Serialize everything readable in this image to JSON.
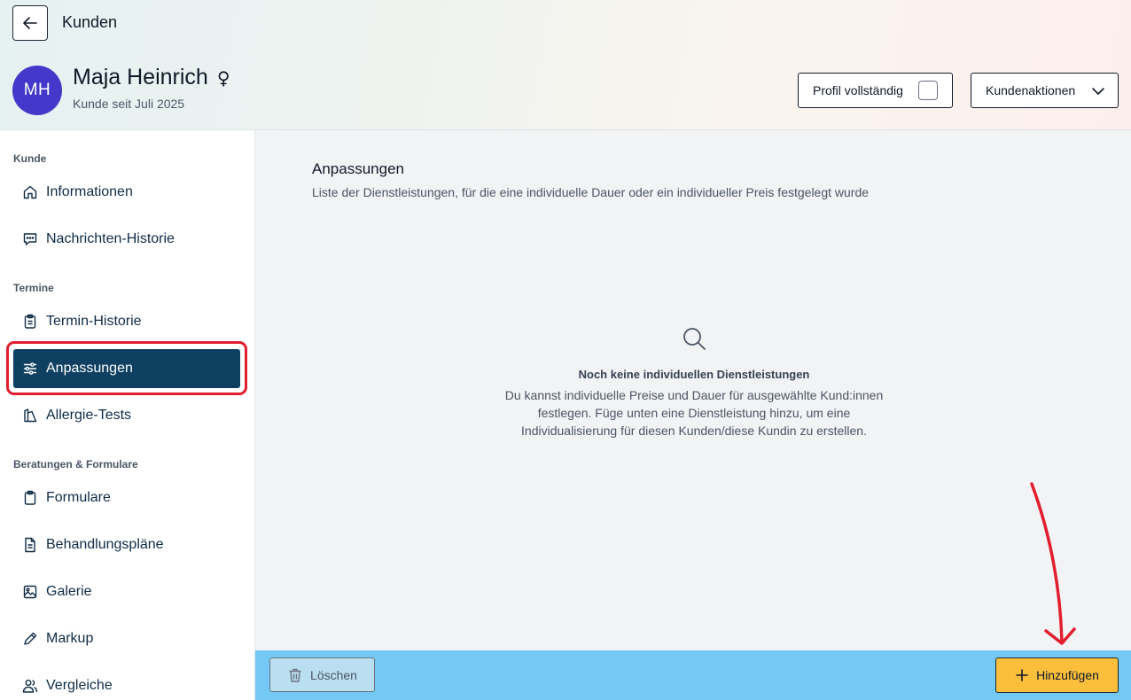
{
  "header": {
    "back_label": "Kunden",
    "customer": {
      "initials": "MH",
      "name": "Maja Heinrich",
      "gender_symbol": "♀",
      "since": "Kunde seit Juli 2025",
      "avatar_color": "#4338ca"
    },
    "profile_complete_label": "Profil vollständig",
    "profile_complete_checked": false,
    "actions_label": "Kundenaktionen"
  },
  "sidebar": {
    "sections": [
      {
        "label": "Kunde",
        "items": [
          {
            "label": "Informationen",
            "icon": "home-icon"
          },
          {
            "label": "Nachrichten-Historie",
            "icon": "message-icon"
          }
        ]
      },
      {
        "label": "Termine",
        "items": [
          {
            "label": "Termin-Historie",
            "icon": "clipboard-list-icon"
          },
          {
            "label": "Anpassungen",
            "icon": "sliders-icon",
            "active": true
          },
          {
            "label": "Allergie-Tests",
            "icon": "allergy-test-icon"
          }
        ]
      },
      {
        "label": "Beratungen & Formulare",
        "items": [
          {
            "label": "Formulare",
            "icon": "clipboard-icon"
          },
          {
            "label": "Behandlungspläne",
            "icon": "document-icon"
          },
          {
            "label": "Galerie",
            "icon": "image-icon"
          },
          {
            "label": "Markup",
            "icon": "pencil-icon"
          },
          {
            "label": "Vergleiche",
            "icon": "users-icon"
          }
        ]
      }
    ],
    "active_color": "#0f3f61"
  },
  "main": {
    "title": "Anpassungen",
    "subtitle": "Liste der Dienstleistungen, für die eine individuelle Dauer oder ein individueller Preis festgelegt wurde",
    "empty": {
      "icon": "search-icon",
      "title": "Noch keine individuellen Dienstleistungen",
      "text": "Du kannst individuelle Preise und Dauer für ausgewählte Kund:innen festlegen. Füge unten eine Dienstleistung hinzu, um eine Individualisierung für diesen Kunden/diese Kundin zu erstellen."
    }
  },
  "footer": {
    "delete_label": "Löschen",
    "add_label": "Hinzufügen",
    "bar_color": "#74c9f4",
    "add_color": "#fbbf3c"
  },
  "annotation_color": "#e11d2e"
}
